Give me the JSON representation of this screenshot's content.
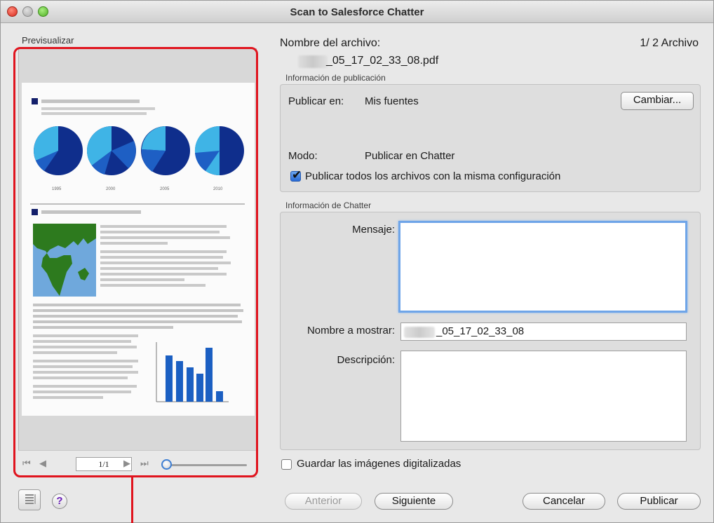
{
  "window": {
    "title": "Scan to Salesforce Chatter"
  },
  "preview": {
    "label": "Previsualizar",
    "page_indicator": "1/1",
    "years": [
      "1995",
      "2000",
      "2005",
      "2010"
    ]
  },
  "file": {
    "label": "Nombre del archivo:",
    "name": "_05_17_02_33_08.pdf",
    "counter": "1/ 2 Archivo"
  },
  "publish_info": {
    "section_label": "Información de publicación",
    "publish_to_label": "Publicar en:",
    "publish_to_value": "Mis fuentes",
    "change_button": "Cambiar...",
    "mode_label": "Modo:",
    "mode_value": "Publicar en Chatter",
    "same_config_label": "Publicar todos los archivos con la misma configuración",
    "same_config_checked": true
  },
  "chatter_info": {
    "section_label": "Información de Chatter",
    "message_label": "Mensaje:",
    "message_value": "",
    "display_name_label": "Nombre a mostrar:",
    "display_name_value": "_05_17_02_33_08",
    "description_label": "Descripción:",
    "description_value": ""
  },
  "save_images": {
    "label": "Guardar las imágenes digitalizadas",
    "checked": false
  },
  "buttons": {
    "previous": "Anterior",
    "next": "Siguiente",
    "cancel": "Cancelar",
    "publish": "Publicar"
  },
  "colors": {
    "highlight": "#e0141e",
    "pie_dark": "#0f2e8c",
    "pie_mid": "#1e5fc4",
    "pie_light": "#3fb4e6",
    "bar": "#1b5fc2",
    "map_land": "#2d7a1e",
    "map_sea": "#6fa8dc"
  }
}
